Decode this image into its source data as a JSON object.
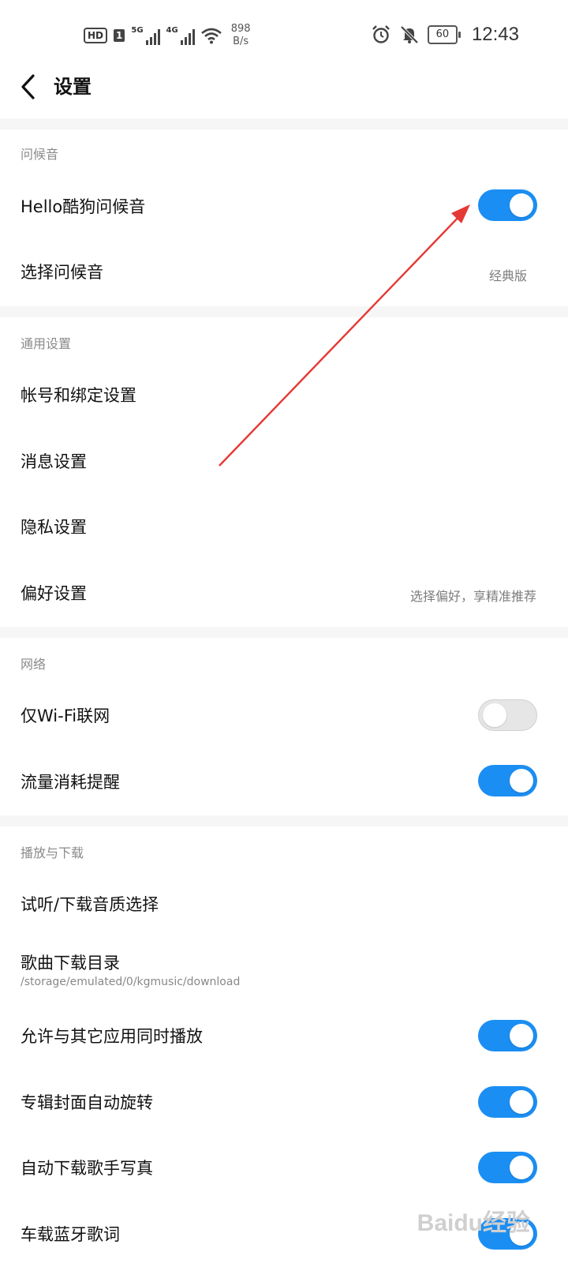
{
  "status_bar": {
    "hd": "HD",
    "sim": "1",
    "net1": "5G",
    "net2": "4G",
    "speed_value": "898",
    "speed_unit": "B/s",
    "battery": "60",
    "time": "12:43"
  },
  "header": {
    "title": "设置"
  },
  "sections": {
    "greeting": {
      "title": "问候音",
      "hello_label": "Hello酷狗问候音",
      "hello_on": true,
      "choose_label": "选择问候音",
      "choose_value": "经典版"
    },
    "general": {
      "title": "通用设置",
      "account": "帐号和绑定设置",
      "message": "消息设置",
      "privacy": "隐私设置",
      "preference": "偏好设置",
      "preference_value": "选择偏好，享精准推荐"
    },
    "network": {
      "title": "网络",
      "wifi_only": "仅Wi-Fi联网",
      "wifi_only_on": false,
      "data_reminder": "流量消耗提醒",
      "data_reminder_on": true
    },
    "playback": {
      "title": "播放与下载",
      "quality": "试听/下载音质选择",
      "dir_label": "歌曲下载目录",
      "dir_path": "/storage/emulated/0/kgmusic/download",
      "mix_play": "允许与其它应用同时播放",
      "mix_play_on": true,
      "rotate_cover": "专辑封面自动旋转",
      "rotate_cover_on": true,
      "auto_photo": "自动下载歌手写真",
      "auto_photo_on": true,
      "car_lyrics": "车载蓝牙歌词",
      "car_lyrics_on": true
    }
  },
  "annotation": {
    "arrow_color": "#e53935"
  },
  "watermark": "Baidu经验",
  "colors": {
    "toggle_on": "#1b8ef3",
    "toggle_off": "#e6e6e6",
    "section_gap": "#f6f6f6"
  }
}
